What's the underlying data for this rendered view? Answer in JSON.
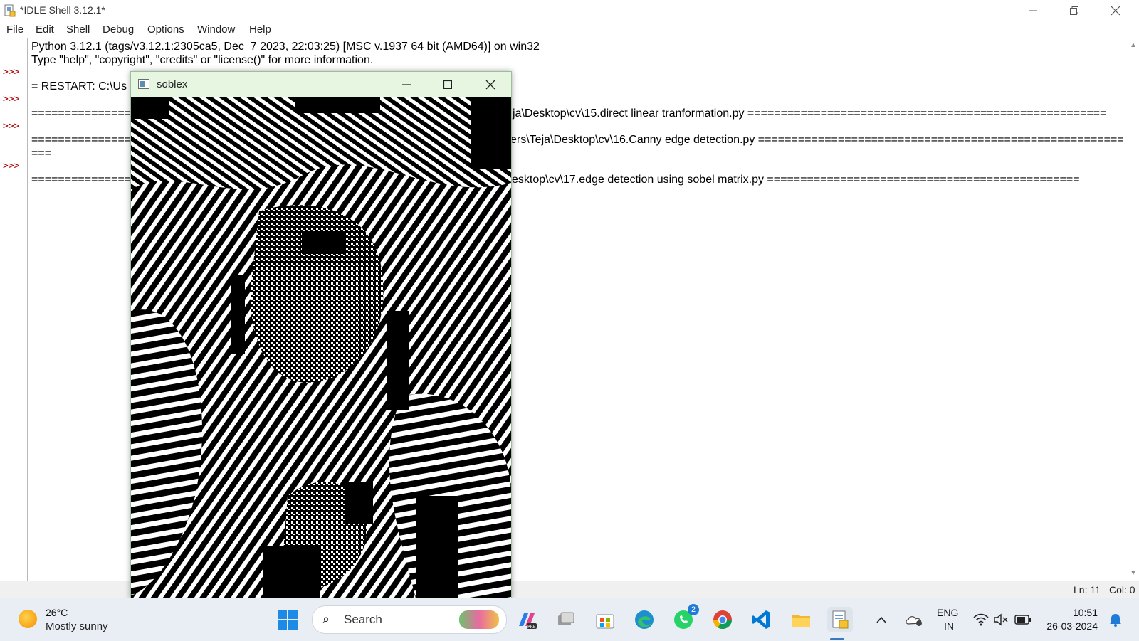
{
  "window": {
    "title": "*IDLE Shell 3.12.1*"
  },
  "menu": [
    "File",
    "Edit",
    "Shell",
    "Debug",
    "Options",
    "Window",
    "Help"
  ],
  "shell": {
    "banner1": "Python 3.12.1 (tags/v3.12.1:2305ca5, Dec  7 2023, 22:03:25) [MSC v.1937 64 bit (AMD64)] on win32",
    "banner2": "Type \"help\", \"copyright\", \"credits\" or \"license()\" for more information.",
    "prompt": ">>>",
    "restart0_left": "= RESTART: C:\\Us",
    "restart1_left": "================",
    "restart1_right": "ja\\Desktop\\cv\\15.direct linear tranformation.py ======================================================",
    "restart2_left": "================",
    "restart2_right": "ers\\Teja\\Desktop\\cv\\16.Canny edge detection.py =======================================================",
    "restart2_wrap": "===",
    "restart3_left": "================",
    "restart3_right": "esktop\\cv\\17.edge detection using sobel matrix.py ==============================================="
  },
  "status": {
    "line": "Ln: 11",
    "col": "Col: 0"
  },
  "cv_window": {
    "title": "soblex"
  },
  "taskbar": {
    "weather_temp": "26°C",
    "weather_desc": "Mostly sunny",
    "search_label": "Search",
    "whatsapp_badge": "2",
    "lang_top": "ENG",
    "lang_bottom": "IN",
    "time": "10:51",
    "date": "26-03-2024"
  },
  "icons": [
    "app-icon",
    "minimize-icon",
    "restore-icon",
    "close-icon",
    "windows-start-icon",
    "search-icon",
    "copilot-icon",
    "file-manager-icon",
    "store-icon",
    "edge-icon",
    "whatsapp-icon",
    "chrome-icon",
    "vscode-icon",
    "folder-icon",
    "idle-icon",
    "chevron-up-icon",
    "onedrive-icon",
    "wifi-icon",
    "volume-muted-icon",
    "battery-icon",
    "notification-bell-icon"
  ],
  "colors": {
    "accent": "#3b78c4",
    "prompt": "#b00000",
    "cv_titlebar": "#e7f6e1",
    "taskbar": "#e9eef4"
  }
}
